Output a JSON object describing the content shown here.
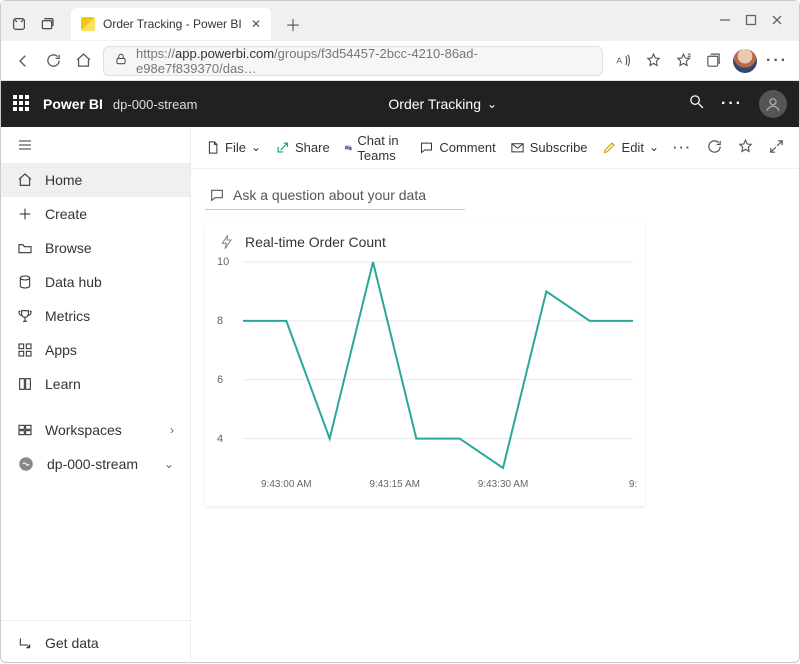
{
  "browser": {
    "tab_title": "Order Tracking - Power BI",
    "url_host": "https://",
    "url_domain": "app.powerbi.com",
    "url_path": "/groups/f3d54457-2bcc-4210-86ad-e98e7f839370/das…"
  },
  "pbi_header": {
    "brand": "Power BI",
    "workspace": "dp-000-stream",
    "dashboard_title": "Order Tracking"
  },
  "sidebar": {
    "items": [
      {
        "label": "Home",
        "icon": "home"
      },
      {
        "label": "Create",
        "icon": "plus"
      },
      {
        "label": "Browse",
        "icon": "folder"
      },
      {
        "label": "Data hub",
        "icon": "datahub"
      },
      {
        "label": "Metrics",
        "icon": "trophy"
      },
      {
        "label": "Apps",
        "icon": "apps"
      },
      {
        "label": "Learn",
        "icon": "book"
      }
    ],
    "workspaces_label": "Workspaces",
    "stream_label": "dp-000-stream",
    "get_data_label": "Get data"
  },
  "toolbar": {
    "file_label": "File",
    "share_label": "Share",
    "chat_label": "Chat in Teams",
    "comment_label": "Comment",
    "subscribe_label": "Subscribe",
    "edit_label": "Edit"
  },
  "qna_placeholder": "Ask a question about your data",
  "tile": {
    "title": "Real-time Order Count"
  },
  "chart_data": {
    "type": "line",
    "title": "Real-time Order Count",
    "xlabel": "",
    "ylabel": "",
    "ylim": [
      3,
      10
    ],
    "y_ticks": [
      4,
      6,
      8,
      10
    ],
    "x_tick_labels": [
      "9:43:00 AM",
      "9:43:15 AM",
      "9:43:30 AM",
      "9:"
    ],
    "x": [
      0,
      1,
      2,
      3,
      4,
      5,
      6,
      7,
      8
    ],
    "values": [
      8,
      8,
      4,
      10,
      4,
      4,
      3,
      9,
      8,
      8
    ],
    "x_tick_positions": [
      1,
      3.5,
      6,
      9
    ]
  }
}
